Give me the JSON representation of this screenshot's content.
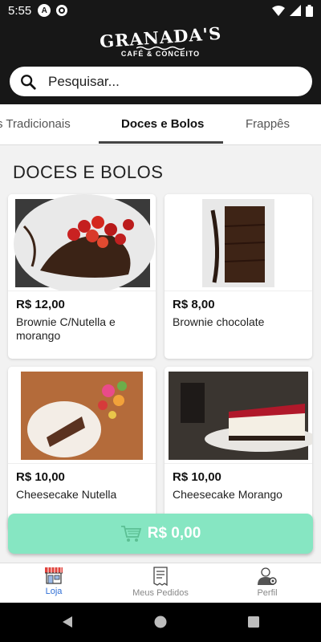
{
  "status_bar": {
    "time": "5:55",
    "app_icon_letter": "A"
  },
  "header": {
    "logo_main": "GRANADA'S",
    "logo_sub": "CAFÉ & CONCEITO",
    "search_placeholder": "Pesquisar..."
  },
  "tabs": [
    {
      "label": "s Tradicionais"
    },
    {
      "label": "Doces e Bolos",
      "active": true
    },
    {
      "label": "Frappês"
    }
  ],
  "section": {
    "title": "DOCES E BOLOS"
  },
  "products": [
    {
      "price": "R$ 12,00",
      "name": "Brownie C/Nutella e morango",
      "image": "brownie-strawberry-photo"
    },
    {
      "price": "R$ 8,00",
      "name": "Brownie chocolate",
      "image": "brownie-photo"
    },
    {
      "price": "R$ 10,00",
      "name": "Cheesecake Nutella",
      "image": "cheesecake-nutella-photo"
    },
    {
      "price": "R$ 10,00",
      "name": "Cheesecake Morango",
      "image": "cheesecake-strawberry-photo"
    }
  ],
  "cart": {
    "label": "R$ 0,00",
    "icon": "cart-icon"
  },
  "bottom_nav": [
    {
      "label": "Loja",
      "icon": "store-icon",
      "active": true
    },
    {
      "label": "Meus Pedidos",
      "icon": "receipt-icon"
    },
    {
      "label": "Perfil",
      "icon": "user-gear-icon"
    }
  ],
  "colors": {
    "header_bg": "#171717",
    "cart_bg": "#86e6c2",
    "nav_active": "#2f6fd6"
  }
}
